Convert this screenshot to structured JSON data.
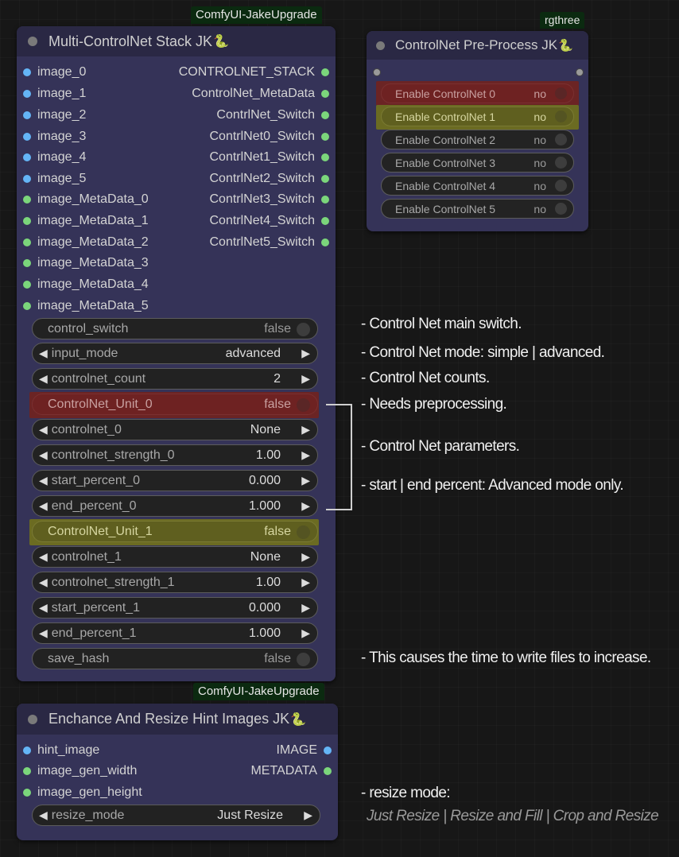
{
  "nodes": {
    "stack": {
      "pack_badge": "ComfyUI-JakeUpgrade",
      "title": "Multi-ControlNet Stack JK",
      "title_icon": "snake-emoji-icon",
      "inputs": [
        "image_0",
        "image_1",
        "image_2",
        "image_3",
        "image_4",
        "image_5",
        "image_MetaData_0",
        "image_MetaData_1",
        "image_MetaData_2",
        "image_MetaData_3",
        "image_MetaData_4",
        "image_MetaData_5"
      ],
      "outputs": [
        "CONTROLNET_STACK",
        "ControlNet_MetaData",
        "ContrlNet_Switch",
        "ContrlNet0_Switch",
        "ContrlNet1_Switch",
        "ContrlNet2_Switch",
        "ContrlNet3_Switch",
        "ContrlNet4_Switch",
        "ContrlNet5_Switch"
      ],
      "widgets": {
        "control_switch": {
          "name": "control_switch",
          "value": "false"
        },
        "input_mode": {
          "name": "input_mode",
          "value": "advanced"
        },
        "controlnet_count": {
          "name": "controlnet_count",
          "value": "2"
        },
        "unit_0": {
          "name": "ControlNet_Unit_0",
          "value": "false"
        },
        "controlnet_0": {
          "name": "controlnet_0",
          "value": "None"
        },
        "controlnet_strength_0": {
          "name": "controlnet_strength_0",
          "value": "1.00"
        },
        "start_percent_0": {
          "name": "start_percent_0",
          "value": "0.000"
        },
        "end_percent_0": {
          "name": "end_percent_0",
          "value": "1.000"
        },
        "unit_1": {
          "name": "ControlNet_Unit_1",
          "value": "false"
        },
        "controlnet_1": {
          "name": "controlnet_1",
          "value": "None"
        },
        "controlnet_strength_1": {
          "name": "controlnet_strength_1",
          "value": "1.00"
        },
        "start_percent_1": {
          "name": "start_percent_1",
          "value": "0.000"
        },
        "end_percent_1": {
          "name": "end_percent_1",
          "value": "1.000"
        },
        "save_hash": {
          "name": "save_hash",
          "value": "false"
        }
      }
    },
    "preprocess": {
      "pack_badge": "rgthree",
      "title": "ControlNet Pre-Process JK",
      "title_icon": "snake-emoji-icon",
      "toggles": [
        {
          "name": "Enable ControlNet 0",
          "value": "no"
        },
        {
          "name": "Enable ControlNet 1",
          "value": "no"
        },
        {
          "name": "Enable ControlNet 2",
          "value": "no"
        },
        {
          "name": "Enable ControlNet 3",
          "value": "no"
        },
        {
          "name": "Enable ControlNet 4",
          "value": "no"
        },
        {
          "name": "Enable ControlNet 5",
          "value": "no"
        }
      ]
    },
    "resize": {
      "pack_badge": "ComfyUI-JakeUpgrade",
      "title": "Enchance And Resize Hint Images JK",
      "title_icon": "snake-emoji-icon",
      "inputs": [
        "hint_image",
        "image_gen_width",
        "image_gen_height"
      ],
      "outputs": [
        "IMAGE",
        "METADATA"
      ],
      "widgets": {
        "resize_mode": {
          "name": "resize_mode",
          "value": "Just Resize"
        }
      }
    }
  },
  "notes": {
    "main_switch": "- Control Net main switch.",
    "mode": "- Control Net mode: simple | advanced.",
    "counts": "- Control Net counts.",
    "preprocessing": "- Needs preprocessing.",
    "parameters": "- Control Net parameters.",
    "percent": "- start | end percent: Advanced mode only.",
    "hash": "- This causes the time to write files to increase.",
    "resize_mode": "- resize mode:",
    "resize_options": "Just Resize | Resize and Fill | Crop and Resize"
  },
  "colors": {
    "node_body": "#353358",
    "node_header": "#2a2844",
    "highlight_red": "#6e2222",
    "highlight_yellow": "#5f5f1f",
    "slot_image": "#64b5f6",
    "slot_metadata": "#7bd67b",
    "badge": "#0b2a10"
  }
}
